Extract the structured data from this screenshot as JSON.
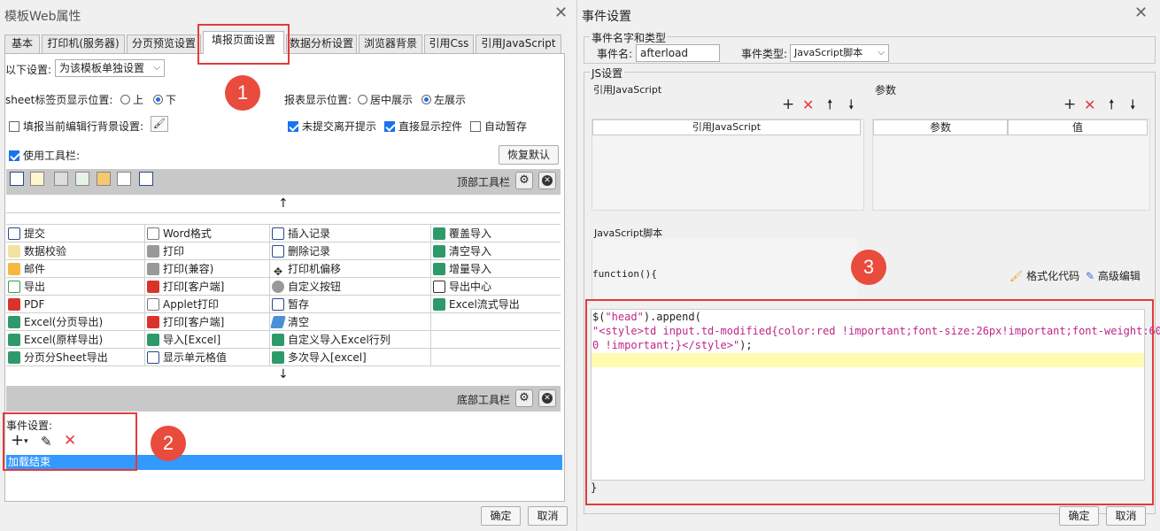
{
  "left": {
    "title": "模板Web属性",
    "tabs": [
      "基本",
      "打印机(服务器)",
      "分页预览设置",
      "填报页面设置",
      "数据分析设置",
      "浏览器背景",
      "引用Css",
      "引用JavaScript"
    ],
    "settings_label": "以下设置:",
    "settings_value": "为该模板单独设置",
    "sheet_pos_label": "sheet标签页显示位置:",
    "sheet_pos_options": [
      "上",
      "下"
    ],
    "report_pos_label": "报表显示位置:",
    "report_pos_options": [
      "居中展示",
      "左展示"
    ],
    "bg_setting_label": "填报当前编辑行背景设置:",
    "unsubmitted_label": "未提交离开提示",
    "direct_display_label": "直接显示控件",
    "autosave_label": "自动暂存",
    "use_toolbar_label": "使用工具栏:",
    "restore_default": "恢复默认",
    "top_toolbar_label": "顶部工具栏",
    "bottom_toolbar_label": "底部工具栏",
    "up_arrow": "↑",
    "down_arrow": "↓",
    "buttons_col1": [
      "提交",
      "数据校验",
      "邮件",
      "导出",
      "PDF",
      "Excel(分页导出)",
      "Excel(原样导出)",
      "分页分Sheet导出"
    ],
    "buttons_col2": [
      "Word格式",
      "打印",
      "打印(兼容)",
      "打印[客户端]",
      "Applet打印",
      "打印[客户端]",
      "导入[Excel]",
      "显示单元格值"
    ],
    "buttons_col3": [
      "插入记录",
      "删除记录",
      "打印机偏移",
      "自定义按钮",
      "暂存",
      "清空",
      "自定义导入Excel行列",
      "多次导入[excel]"
    ],
    "buttons_col4": [
      "覆盖导入",
      "清空导入",
      "增量导入",
      "导出中心",
      "Excel流式导出"
    ],
    "event_settings_label": "事件设置:",
    "event_item": "加载结束",
    "ok": "确定",
    "cancel": "取消"
  },
  "right": {
    "title": "事件设置",
    "group_name_type": "事件名字和类型",
    "event_name_label": "事件名:",
    "event_name_value": "afterload",
    "event_type_label": "事件类型:",
    "event_type_value": "JavaScript脚本",
    "js_settings": "JS设置",
    "ref_js_label": "引用JavaScript",
    "params_label": "参数",
    "ref_js_col": "引用JavaScript",
    "param_cols": [
      "参数",
      "值"
    ],
    "js_script_label": "JavaScript脚本",
    "func_header": "function(){",
    "format_code": "格式化代码",
    "advanced_edit": "高级编辑",
    "code_line1_a": "$(",
    "code_line1_str": "\"head\"",
    "code_line1_b": ").append(",
    "code_line2": "\"<style>td input.td-modified{color:red !important;font-size:26px!important;font-weight:60",
    "code_line3_str": "0 !important;}</style>\"",
    "code_line3_b": ");",
    "func_footer": "}",
    "ok": "确定",
    "cancel": "取消"
  },
  "badges": [
    "1",
    "2",
    "3"
  ],
  "colors": {
    "accent": "#1a73e8",
    "highlight": "#e23b3b",
    "badge": "#e94b3c",
    "selection": "#3399ff",
    "code_string": "#c0258a"
  }
}
